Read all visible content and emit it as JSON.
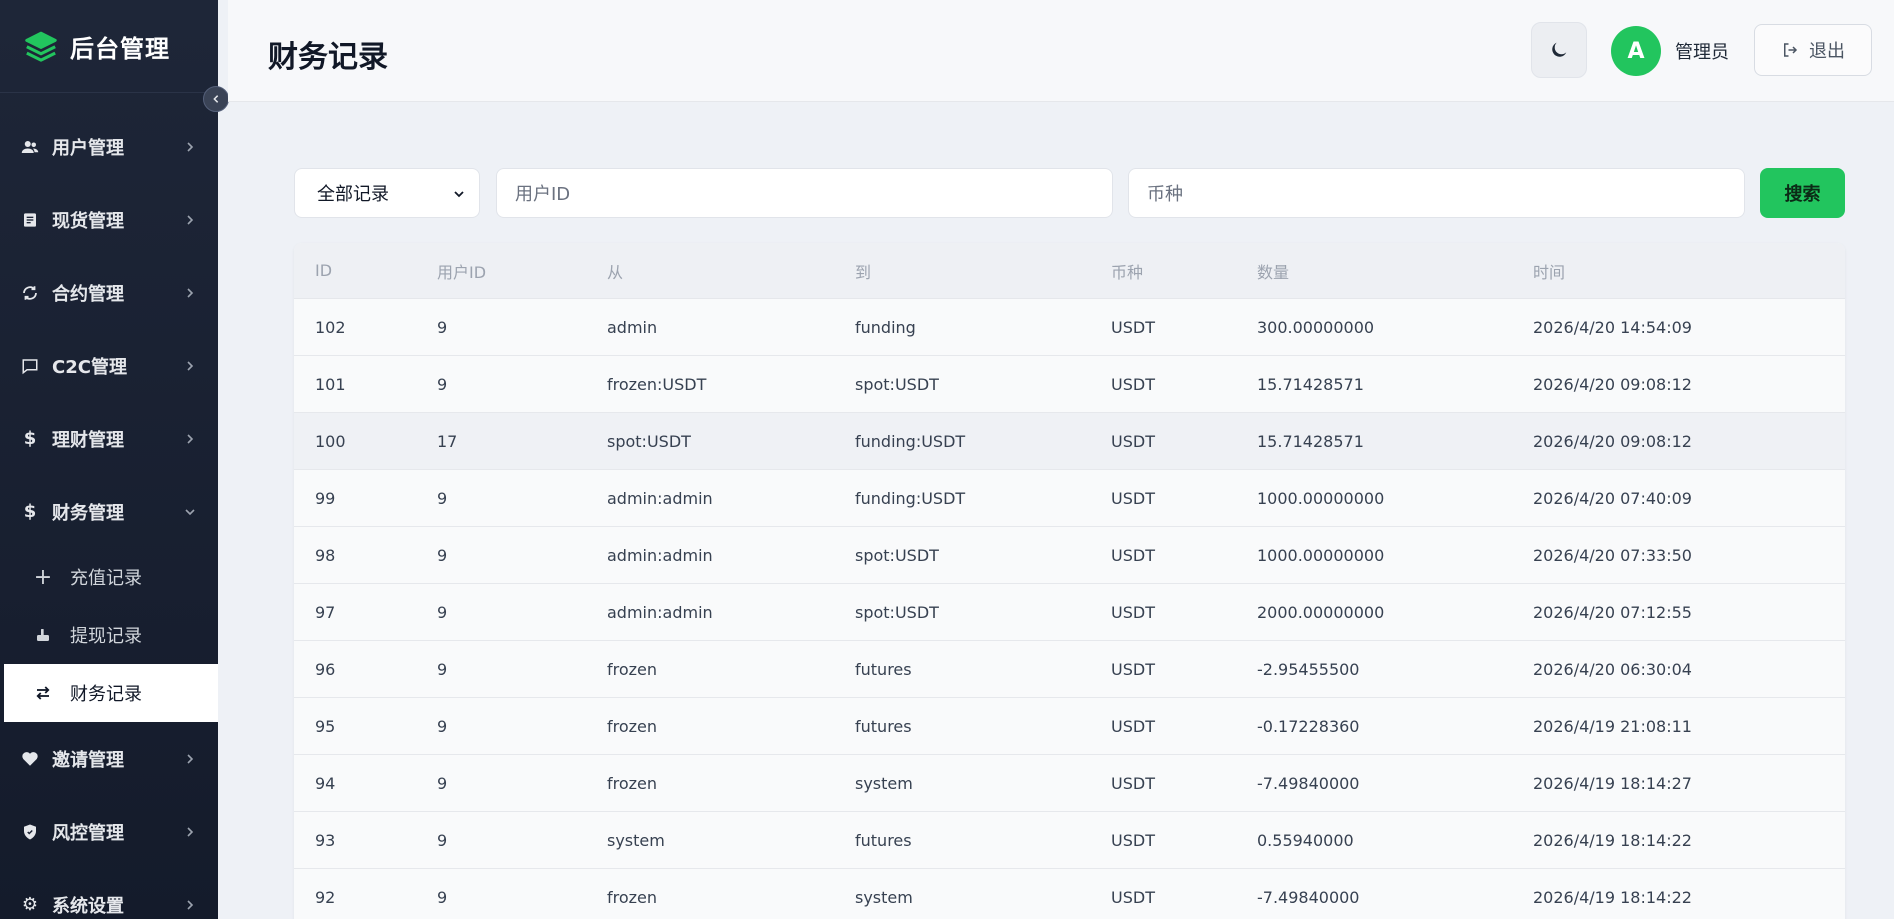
{
  "brand": {
    "name": "后台管理"
  },
  "sidebar": {
    "items": [
      {
        "label": "用户管理",
        "icon": "users-icon"
      },
      {
        "label": "现货管理",
        "icon": "spot-icon"
      },
      {
        "label": "合约管理",
        "icon": "contract-icon"
      },
      {
        "label": "C2C管理",
        "icon": "chat-icon"
      },
      {
        "label": "理财管理",
        "icon": "dollar-icon"
      },
      {
        "label": "财务管理",
        "icon": "dollar-icon",
        "expanded": true
      }
    ],
    "sub_items": [
      {
        "label": "充值记录",
        "icon": "plus-icon"
      },
      {
        "label": "提现记录",
        "icon": "hand-icon"
      },
      {
        "label": "财务记录",
        "icon": "transfer-icon",
        "active": true
      }
    ],
    "items_after": [
      {
        "label": "邀请管理",
        "icon": "heart-icon"
      },
      {
        "label": "风控管理",
        "icon": "shield-icon"
      },
      {
        "label": "系统设置",
        "icon": "gear-icon"
      }
    ]
  },
  "header": {
    "title": "财务记录",
    "avatar_letter": "A",
    "username": "管理员",
    "logout_label": "退出"
  },
  "filter": {
    "select_value": "全部记录",
    "uid_placeholder": "用户ID",
    "coin_placeholder": "币种",
    "search_label": "搜索"
  },
  "table": {
    "columns": [
      "ID",
      "用户ID",
      "从",
      "到",
      "币种",
      "数量",
      "时间"
    ],
    "rows": [
      [
        "102",
        "9",
        "admin",
        "funding",
        "USDT",
        "300.00000000",
        "2026/4/20 14:54:09"
      ],
      [
        "101",
        "9",
        "frozen:USDT",
        "spot:USDT",
        "USDT",
        "15.71428571",
        "2026/4/20 09:08:12"
      ],
      [
        "100",
        "17",
        "spot:USDT",
        "funding:USDT",
        "USDT",
        "15.71428571",
        "2026/4/20 09:08:12"
      ],
      [
        "99",
        "9",
        "admin:admin",
        "funding:USDT",
        "USDT",
        "1000.00000000",
        "2026/4/20 07:40:09"
      ],
      [
        "98",
        "9",
        "admin:admin",
        "spot:USDT",
        "USDT",
        "1000.00000000",
        "2026/4/20 07:33:50"
      ],
      [
        "97",
        "9",
        "admin:admin",
        "spot:USDT",
        "USDT",
        "2000.00000000",
        "2026/4/20 07:12:55"
      ],
      [
        "96",
        "9",
        "frozen",
        "futures",
        "USDT",
        "-2.95455500",
        "2026/4/20 06:30:04"
      ],
      [
        "95",
        "9",
        "frozen",
        "futures",
        "USDT",
        "-0.17228360",
        "2026/4/19 21:08:11"
      ],
      [
        "94",
        "9",
        "frozen",
        "system",
        "USDT",
        "-7.49840000",
        "2026/4/19 18:14:27"
      ],
      [
        "93",
        "9",
        "system",
        "futures",
        "USDT",
        "0.55940000",
        "2026/4/19 18:14:22"
      ],
      [
        "92",
        "9",
        "frozen",
        "system",
        "USDT",
        "-7.49840000",
        "2026/4/19 18:14:22"
      ]
    ]
  },
  "colors": {
    "accent": "#22c55e",
    "sidebar_bg": "#1a2233"
  }
}
